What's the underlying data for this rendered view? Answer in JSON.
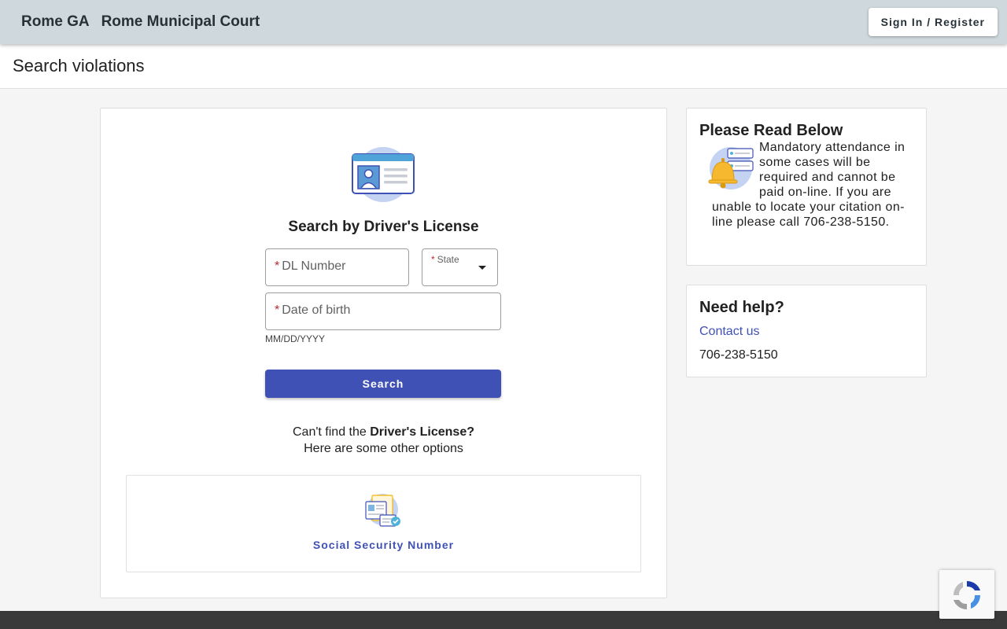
{
  "header": {
    "brand": "Rome GA",
    "court_name": "Rome Municipal Court",
    "signin_label": "Sign In / Register"
  },
  "page": {
    "title": "Search violations"
  },
  "search": {
    "heading": "Search by Driver's License",
    "required_mark": "*",
    "dl_label": "DL Number",
    "state_label": "State",
    "dob_label": "Date of birth",
    "dob_hint": "MM/DD/YYYY",
    "button_label": "Search"
  },
  "alternatives": {
    "prefix": "Can't find the ",
    "bold": "Driver's License?",
    "line2": "Here are some other options",
    "options": [
      {
        "label": "Social Security Number",
        "icon": "ssn-document-icon"
      }
    ]
  },
  "notice": {
    "title": "Please Read Below",
    "body": "Mandatory attendance in some cases will be required and cannot be paid on-line. If you are unable to locate your citation on-line please call 706-238-5150.",
    "icon": "bell-notification-icon"
  },
  "help": {
    "title": "Need help?",
    "contact_label": "Contact us",
    "phone": "706-238-5150"
  },
  "colors": {
    "primary": "#3f51b5",
    "topbar": "#cfd8dc",
    "required": "#c62828",
    "footer": "#3a3a3a"
  }
}
